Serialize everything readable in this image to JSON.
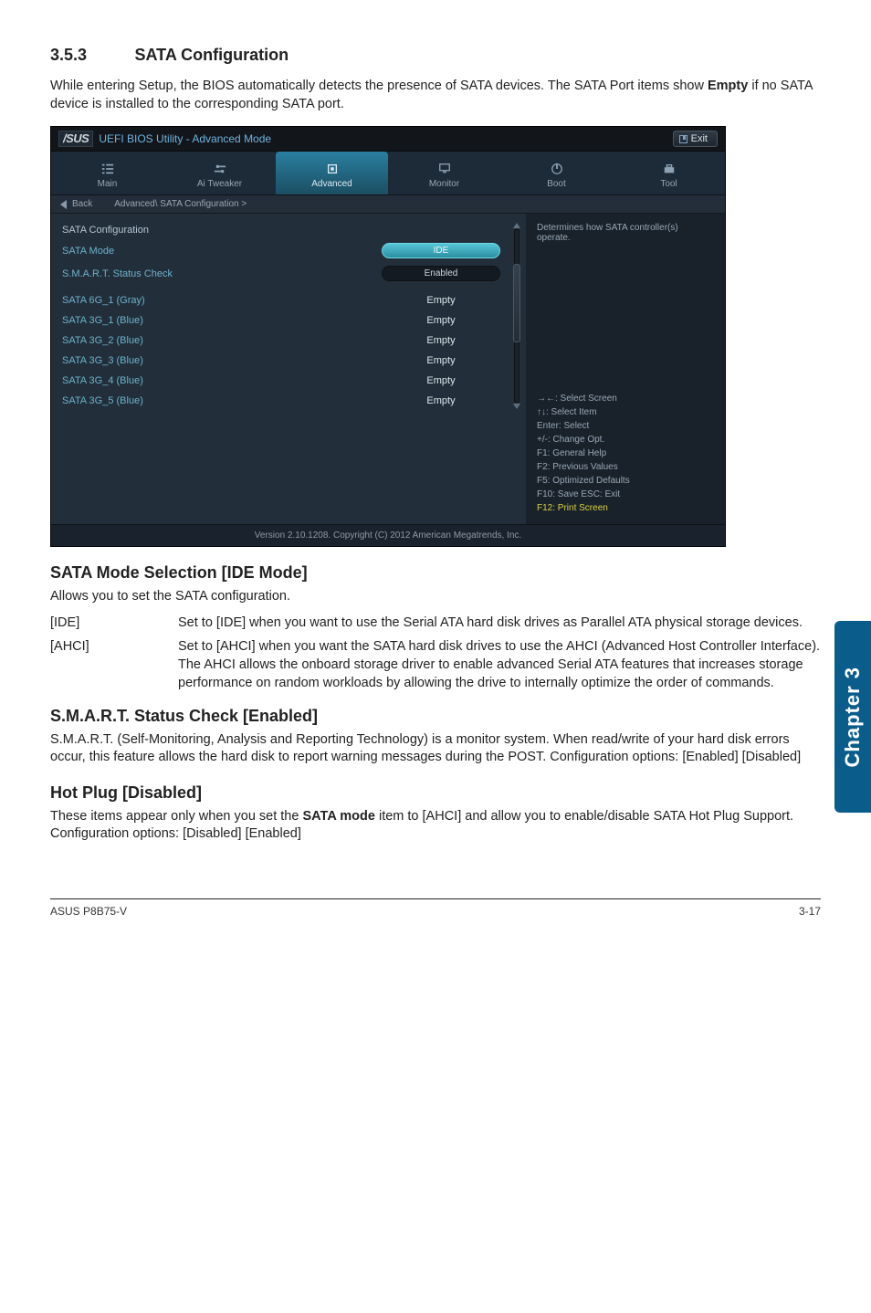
{
  "section": {
    "number": "3.5.3",
    "title": "SATA Configuration"
  },
  "intro": "While entering Setup, the BIOS automatically detects the presence of SATA devices. The SATA Port items show Empty if no SATA device is installed to the corresponding SATA port.",
  "intro_bold": "Empty",
  "bios": {
    "logo": "/SUS",
    "title": "UEFI BIOS Utility - Advanced Mode",
    "exit": "Exit",
    "tabs": {
      "main": "Main",
      "tweaker": "Ai  Tweaker",
      "advanced": "Advanced",
      "monitor": "Monitor",
      "boot": "Boot",
      "tool": "Tool"
    },
    "back": "Back",
    "breadcrumb": "Advanced\\ SATA Configuration >",
    "panel_header": "SATA Configuration",
    "rows": {
      "mode_label": "SATA Mode",
      "mode_value": "IDE",
      "smart_label": "S.M.A.R.T. Status Check",
      "smart_value": "Enabled"
    },
    "ports": [
      {
        "label": "SATA 6G_1 (Gray)",
        "value": "Empty"
      },
      {
        "label": "SATA 3G_1 (Blue)",
        "value": "Empty"
      },
      {
        "label": "SATA 3G_2 (Blue)",
        "value": "Empty"
      },
      {
        "label": "SATA 3G_3 (Blue)",
        "value": "Empty"
      },
      {
        "label": "SATA 3G_4 (Blue)",
        "value": "Empty"
      },
      {
        "label": "SATA 3G_5 (Blue)",
        "value": "Empty"
      }
    ],
    "help_text": "Determines how SATA controller(s) operate.",
    "keys": [
      "→←: Select Screen",
      "↑↓: Select Item",
      "Enter: Select",
      "+/-: Change Opt.",
      "F1: General Help",
      "F2: Previous Values",
      "F5: Optimized Defaults",
      "F10: Save   ESC: Exit",
      "F12: Print Screen"
    ],
    "footer": "Version 2.10.1208. Copyright (C) 2012 American Megatrends, Inc."
  },
  "sata_mode": {
    "heading": "SATA Mode Selection [IDE Mode]",
    "desc": "Allows you to set the SATA configuration.",
    "options": [
      {
        "key": "[IDE]",
        "text": "Set to [IDE] when you want to use the Serial ATA hard disk drives as Parallel ATA physical storage devices."
      },
      {
        "key": "[AHCI]",
        "text": "Set to [AHCI] when you want the SATA hard disk drives to use the AHCI (Advanced Host Controller Interface). The AHCI allows the onboard storage driver to enable advanced Serial ATA features that increases storage performance on random workloads by allowing the drive to internally optimize the order of commands."
      }
    ]
  },
  "smart": {
    "heading": "S.M.A.R.T. Status Check [Enabled]",
    "desc": "S.M.A.R.T. (Self-Monitoring, Analysis and Reporting Technology) is a monitor system. When read/write of your hard disk errors occur, this feature allows the hard disk to report warning messages during the POST. Configuration options: [Enabled] [Disabled]"
  },
  "hotplug": {
    "heading": "Hot Plug [Disabled]",
    "desc_pre": "These items appear only when you set the ",
    "desc_bold": "SATA mode",
    "desc_post": " item to [AHCI] and allow you to enable/disable SATA Hot Plug Support. Configuration options: [Disabled] [Enabled]"
  },
  "side_tab": "Chapter 3",
  "footer": {
    "left": "ASUS P8B75-V",
    "right": "3-17"
  }
}
